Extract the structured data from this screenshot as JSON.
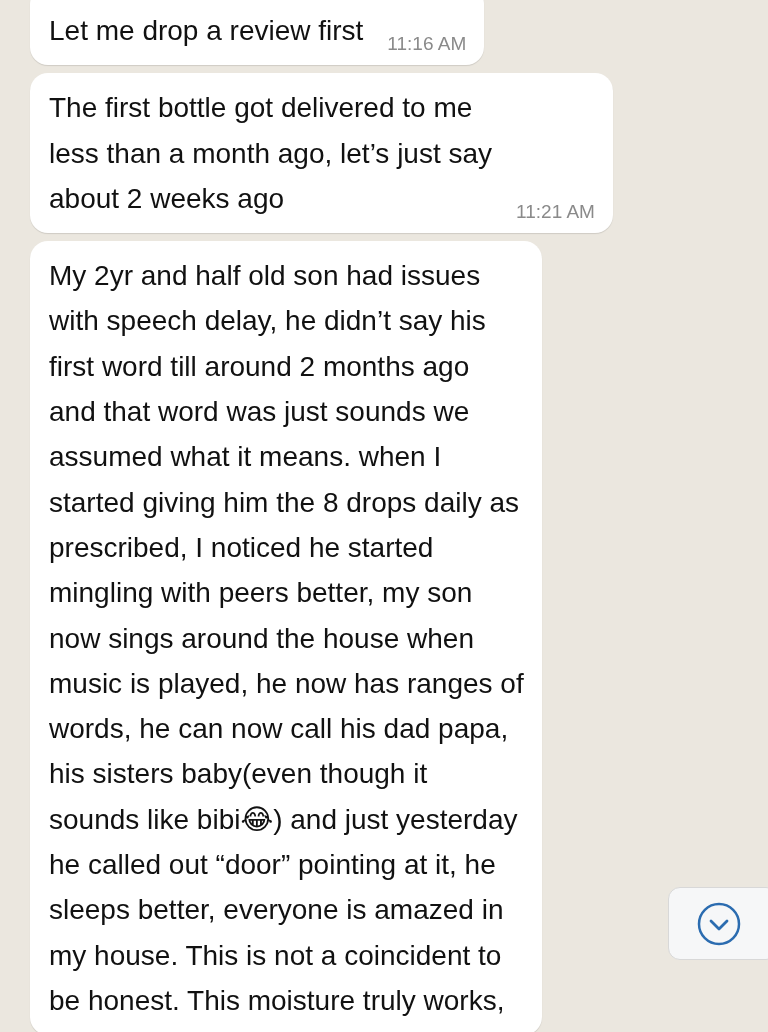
{
  "messages": [
    {
      "text": "Let me drop a review first",
      "time": "11:16 AM"
    },
    {
      "text": "The first bottle got delivered to me\nless than a month ago, let’s just say\nabout 2 weeks ago",
      "time": "11:21 AM"
    },
    {
      "text": "My 2yr and half old son had issues\nwith speech delay, he didn’t say his\nfirst word till around 2 months ago\nand that word was just sounds we\nassumed what it means. when I\nstarted giving him the 8 drops daily as\nprescribed, I noticed he started\nmingling with peers better, my son\nnow sings around the house when\nmusic is played, he now has ranges of\nwords, he can now call his dad papa,\nhis sisters baby(even though it\nsounds like bibi😂) and just yesterday\nhe called out “door” pointing at it, he\nsleeps better, everyone is amazed in\nmy house. This is not a coincident to\nbe honest. This moisture truly works,"
    }
  ]
}
